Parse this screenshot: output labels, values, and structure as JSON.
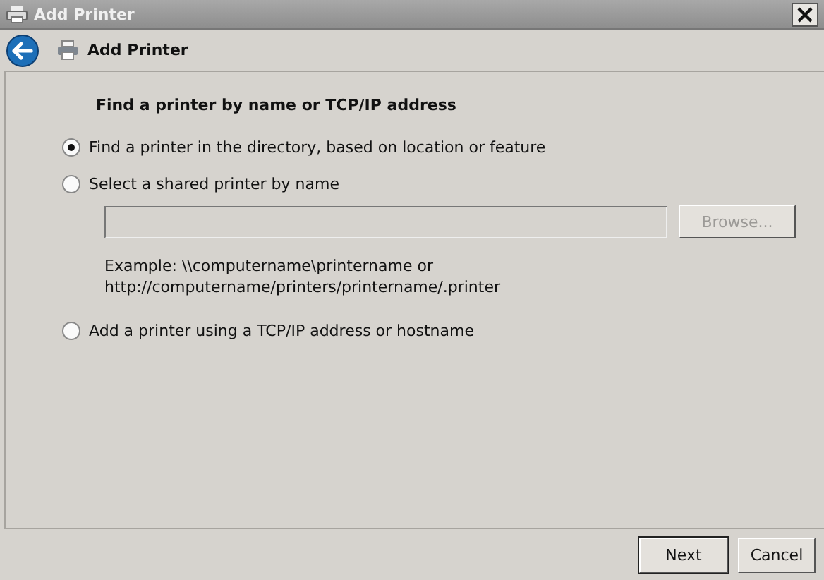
{
  "window": {
    "title": "Add Printer"
  },
  "header": {
    "title": "Add Printer"
  },
  "heading": "Find a printer by name or TCP/IP address",
  "options": [
    {
      "label": "Find a printer in the directory, based on location or feature",
      "selected": true
    },
    {
      "label": "Select a shared printer by name",
      "selected": false,
      "field": {
        "disabled": true,
        "browse": {
          "label": "Browse...",
          "disabled": true
        },
        "example": [
          "Example: \\\\computername\\printername or",
          "http://computername/printers/printername/.printer"
        ]
      }
    },
    {
      "label": "Add a printer using a TCP/IP address or hostname",
      "selected": false
    }
  ],
  "buttons": [
    {
      "label": "Next",
      "default": true
    },
    {
      "label": "Cancel",
      "default": false
    }
  ]
}
